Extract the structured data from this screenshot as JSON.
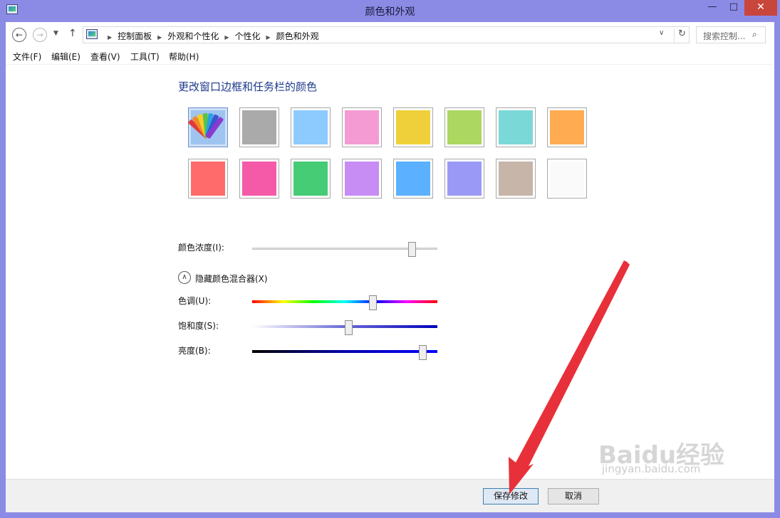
{
  "window": {
    "title": "颜色和外观",
    "min_label": "—",
    "max_label": "□",
    "close_label": "✕"
  },
  "nav": {
    "back_icon": "←",
    "forward_icon": "→",
    "recent_icon": "▼",
    "up_icon": "↑",
    "breadcrumbs": [
      "控制面板",
      "外观和个性化",
      "个性化",
      "颜色和外观"
    ],
    "crumb_sep": "▶",
    "dropdown_icon": "∨",
    "refresh_icon": "↻",
    "search_placeholder": "搜索控制...",
    "search_icon": "⌕"
  },
  "menu": [
    "文件(F)",
    "编辑(E)",
    "查看(V)",
    "工具(T)",
    "帮助(H)"
  ],
  "heading": "更改窗口边框和任务栏的颜色",
  "swatches": [
    {
      "name": "auto-color",
      "color": "#9fc4f0",
      "selected": true
    },
    {
      "name": "gray",
      "color": "#aaaaaa"
    },
    {
      "name": "sky-blue",
      "color": "#8dcbff"
    },
    {
      "name": "pink",
      "color": "#f59bd3"
    },
    {
      "name": "yellow",
      "color": "#f0d03a"
    },
    {
      "name": "lime",
      "color": "#acd760"
    },
    {
      "name": "teal",
      "color": "#7ad9d6"
    },
    {
      "name": "orange",
      "color": "#ffab52"
    },
    {
      "name": "red",
      "color": "#ff6b6b"
    },
    {
      "name": "magenta",
      "color": "#f45aa8"
    },
    {
      "name": "green",
      "color": "#46cc74"
    },
    {
      "name": "violet",
      "color": "#c88cf5"
    },
    {
      "name": "blue",
      "color": "#5bb0ff"
    },
    {
      "name": "periwinkle",
      "color": "#9a9af6"
    },
    {
      "name": "taupe",
      "color": "#c6b5a8"
    },
    {
      "name": "white",
      "color": "#fafafa"
    }
  ],
  "intensity": {
    "label": "颜色浓度(I):",
    "value": 0.86
  },
  "mixer": {
    "toggle_icon": "∧",
    "toggle_label": "隐藏颜色混合器(X)",
    "hue": {
      "label": "色调(U):",
      "value": 0.65
    },
    "saturation": {
      "label": "饱和度(S):",
      "value": 0.52
    },
    "brightness": {
      "label": "亮度(B):",
      "value": 0.92
    }
  },
  "buttons": {
    "save": "保存修改",
    "cancel": "取消"
  },
  "watermark": {
    "text": "Baidu经验",
    "sub": "jingyan.baidu.com"
  },
  "annotation": {
    "color": "#e8303a"
  }
}
